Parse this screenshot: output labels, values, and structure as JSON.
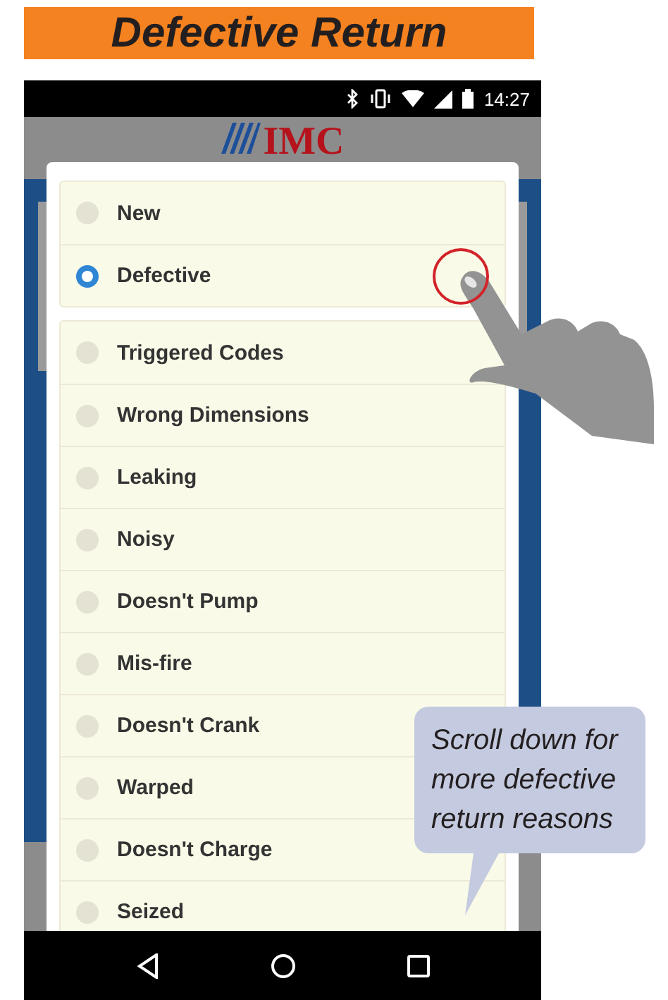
{
  "title": "Defective Return",
  "status_bar": {
    "time": "14:27"
  },
  "app_header": {
    "logo": "IMC"
  },
  "dialog": {
    "groups": [
      {
        "options": [
          {
            "label": "New",
            "selected": false
          },
          {
            "label": "Defective",
            "selected": true
          }
        ]
      },
      {
        "options": [
          {
            "label": "Triggered Codes",
            "selected": false
          },
          {
            "label": "Wrong Dimensions",
            "selected": false
          },
          {
            "label": "Leaking",
            "selected": false
          },
          {
            "label": "Noisy",
            "selected": false
          },
          {
            "label": "Doesn't Pump",
            "selected": false
          },
          {
            "label": "Mis-fire",
            "selected": false
          },
          {
            "label": "Doesn't Crank",
            "selected": false
          },
          {
            "label": "Warped",
            "selected": false
          },
          {
            "label": "Doesn't Charge",
            "selected": false
          },
          {
            "label": "Seized",
            "selected": false
          }
        ]
      }
    ]
  },
  "callout": {
    "text": "Scroll down for more defective return reasons"
  }
}
